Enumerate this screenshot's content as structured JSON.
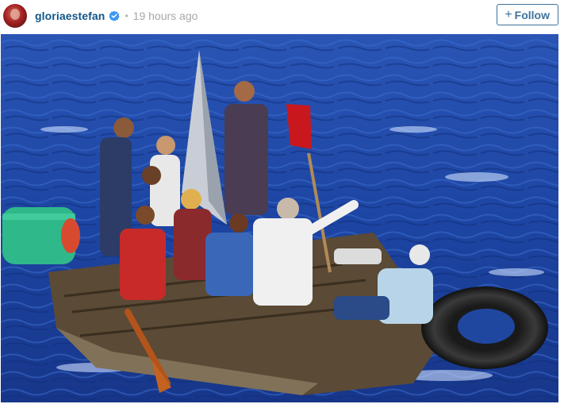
{
  "post": {
    "username": "gloriaestefan",
    "separator": "•",
    "timestamp": "19 hours ago",
    "follow_button": {
      "plus": "+",
      "label": "Follow"
    },
    "icons": {
      "avatar": "profile-avatar",
      "verified": "verified-badge-icon"
    },
    "colors": {
      "username": "#125688",
      "follow_border": "#3f729b",
      "verified_badge": "#3897f0",
      "timestamp": "#a5a7aa"
    }
  }
}
